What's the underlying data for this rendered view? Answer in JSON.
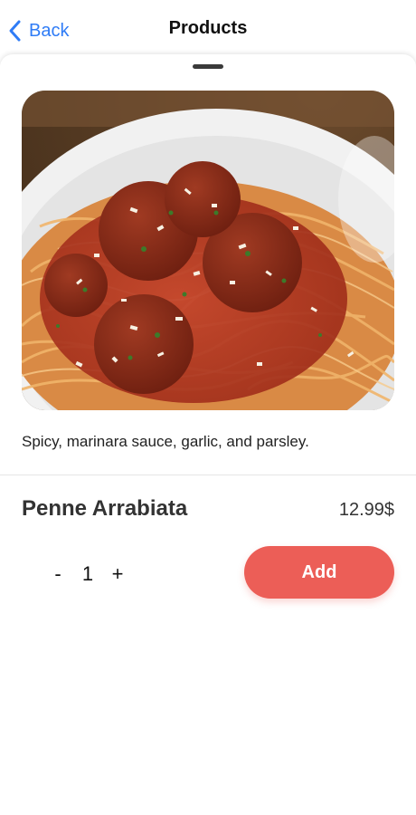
{
  "nav": {
    "back_label": "Back",
    "title": "Products"
  },
  "product": {
    "image_icon": "spaghetti-meatballs-photo",
    "description": "Spicy, marinara sauce, garlic, and parsley.",
    "name": "Penne Arrabiata",
    "price": "12.99$"
  },
  "stepper": {
    "minus_label": "-",
    "quantity": "1",
    "plus_label": "+"
  },
  "actions": {
    "add_label": "Add"
  },
  "colors": {
    "accent_blue": "#2f7cf6",
    "add_button": "#ec5e57",
    "sauce": "#b8361f",
    "pasta": "#e8a45a"
  }
}
